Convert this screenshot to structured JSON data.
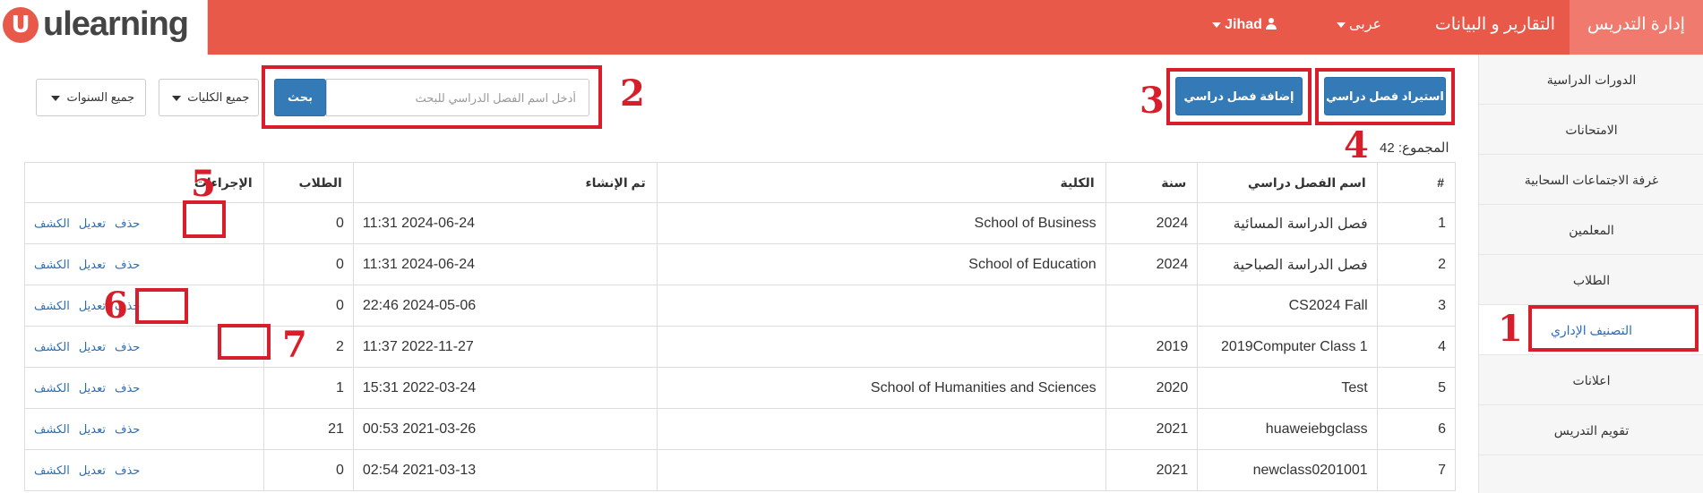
{
  "app": {
    "logo_glyph": "U",
    "logo_text": "ulearning",
    "accent_color": "#e8594a",
    "button_color": "#337ab7"
  },
  "topnav": {
    "teaching_admin": "إدارة التدريس",
    "reports": "التقارير و البيانات",
    "language": "عربى",
    "user": "Jihad"
  },
  "sidebar": {
    "items": [
      {
        "label": "الدورات الدراسية"
      },
      {
        "label": "الامتحانات"
      },
      {
        "label": "غرفة الاجتماعات السحابية"
      },
      {
        "label": "المعلمين"
      },
      {
        "label": "الطلاب"
      },
      {
        "label": "التصنيف الإداري",
        "active": true
      },
      {
        "label": "اعلانات"
      },
      {
        "label": "تقويم التدريس"
      }
    ]
  },
  "toolbar": {
    "import_label": "استيراد فصل دراسي",
    "add_label": "إضافة فصل دراسي",
    "search_label": "بحث",
    "search_placeholder": "أدخل اسم الفصل الدراسي للبحث",
    "faculty_filter": "جميع الكليات",
    "year_filter": "جميع السنوات"
  },
  "summary": {
    "total_text": "المجموع: 42"
  },
  "table": {
    "headers": {
      "index": "#",
      "name": "اسم الفصل دراسي",
      "year": "سنة",
      "faculty": "الكلية",
      "created": "تم الإنشاء",
      "students": "الطلاب",
      "actions": "الإجراءات"
    },
    "action_labels": {
      "roster": "الكشف",
      "edit": "تعديل",
      "delete": "حذف"
    },
    "rows": [
      {
        "index": "1",
        "name": "فصل الدراسة المسائية",
        "year": "2024",
        "faculty": "School of Business",
        "created": "2024-06-24 11:31",
        "students": "0"
      },
      {
        "index": "2",
        "name": "فصل الدراسة الصباحية",
        "year": "2024",
        "faculty": "School of Education",
        "created": "2024-06-24 11:31",
        "students": "0"
      },
      {
        "index": "3",
        "name": "CS2024 Fall",
        "year": "",
        "faculty": "",
        "created": "2024-05-06 22:46",
        "students": "0"
      },
      {
        "index": "4",
        "name": "2019Computer Class 1",
        "year": "2019",
        "faculty": "",
        "created": "2022-11-27 11:37",
        "students": "2"
      },
      {
        "index": "5",
        "name": "Test",
        "year": "2020",
        "faculty": "School of Humanities and Sciences",
        "created": "2022-03-24 15:31",
        "students": "1"
      },
      {
        "index": "6",
        "name": "huaweiebgclass",
        "year": "2021",
        "faculty": "",
        "created": "2021-03-26 00:53",
        "students": "21"
      },
      {
        "index": "7",
        "name": "newclass0201001",
        "year": "2021",
        "faculty": "",
        "created": "2021-03-13 02:54",
        "students": "0"
      }
    ]
  },
  "annotations": {
    "color": "#d81e2a",
    "labels": [
      "1",
      "2",
      "3",
      "4",
      "5",
      "6",
      "7"
    ]
  }
}
